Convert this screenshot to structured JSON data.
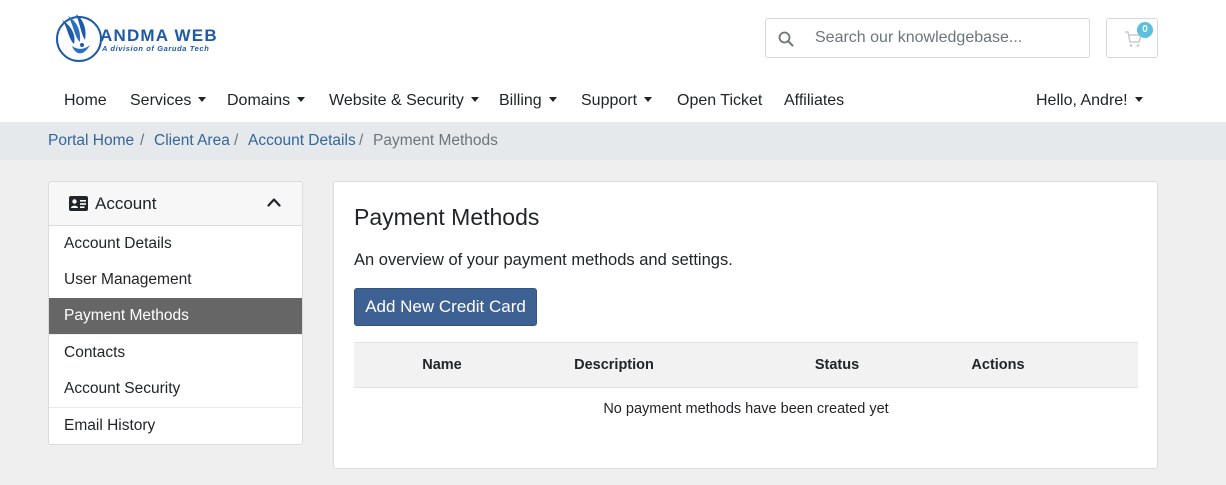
{
  "brand": {
    "name": "ANDMA WEB",
    "tagline": "A division of Garuda Tech",
    "color": "#1e5aa8"
  },
  "search": {
    "placeholder": "Search our knowledgebase...",
    "value": "",
    "icon": "search-icon"
  },
  "cart": {
    "count": "0",
    "icon": "cart-icon"
  },
  "nav": {
    "items": [
      {
        "label": "Home",
        "dropdown": false
      },
      {
        "label": "Services",
        "dropdown": true
      },
      {
        "label": "Domains",
        "dropdown": true
      },
      {
        "label": "Website & Security",
        "dropdown": true
      },
      {
        "label": "Billing",
        "dropdown": true
      },
      {
        "label": "Support",
        "dropdown": true
      },
      {
        "label": "Open Ticket",
        "dropdown": false
      },
      {
        "label": "Affiliates",
        "dropdown": false
      }
    ],
    "user_label": "Hello, Andre!"
  },
  "breadcrumb": [
    {
      "label": "Portal Home"
    },
    {
      "label": "Client Area"
    },
    {
      "label": "Account Details"
    },
    {
      "label": "Payment Methods"
    }
  ],
  "sidebar": {
    "title": "Account",
    "icon": "id-card-icon",
    "items": [
      {
        "label": "Account Details",
        "active": false
      },
      {
        "label": "User Management",
        "active": false
      },
      {
        "label": "Payment Methods",
        "active": true
      },
      {
        "label": "Contacts",
        "active": false
      },
      {
        "label": "Account Security",
        "active": false
      },
      {
        "label": "Email History",
        "active": false
      }
    ]
  },
  "main": {
    "title": "Payment Methods",
    "description": "An overview of your payment methods and settings.",
    "add_button": "Add New Credit Card",
    "table": {
      "columns": [
        "Name",
        "Description",
        "Status",
        "Actions"
      ],
      "empty_message": "No payment methods have been created yet"
    }
  },
  "colors": {
    "accent": "#3e6193",
    "link": "#336699",
    "active_sidebar": "#666666",
    "badge": "#5bc0de"
  }
}
